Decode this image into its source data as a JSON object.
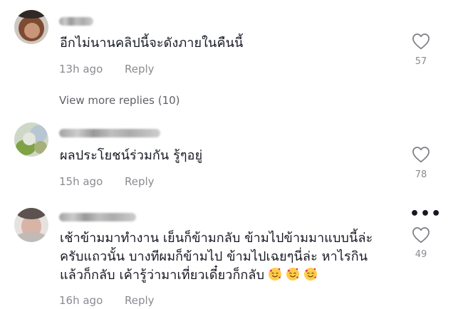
{
  "comments": [
    {
      "text_lines": [
        "อีกไม่นานคลิปนี้จะดังภายในคืนนี้"
      ],
      "time": "13h ago",
      "reply_label": "Reply",
      "likes": "57",
      "icon": "heart-outline-icon"
    },
    {
      "text_lines": [
        "ผลประโยชน์ร่วมกัน รู้ๆอยู่"
      ],
      "time": "15h ago",
      "reply_label": "Reply",
      "likes": "78",
      "icon": "heart-outline-icon"
    },
    {
      "text_lines": [
        "เช้าข้ามมาทำงาน เย็นก็ข้ามกลับ ข้ามไปข้ามมาแบบนี้ล่ะ",
        "ครับแถวนั้น บางทีผมก็ข้ามไป ข้ามไปเฉยๆนี่ล่ะ หาไรกิน",
        "แล้วก็กลับ เค้ารู้ว่ามาเที่ยวเดี๋ยวก็กลับ"
      ],
      "emojis": [
        "smiling-face-with-hearts",
        "smiling-face-with-hearts",
        "smiling-face-with-hearts"
      ],
      "time": "16h ago",
      "reply_label": "Reply",
      "likes": "49",
      "icon": "heart-outline-icon",
      "more_icon": "more-options-icon"
    }
  ],
  "view_more_replies": "View more replies (10)",
  "colors": {
    "text": "#161823",
    "meta": "#8a8b91",
    "view_more": "#5f6066",
    "background": "#ffffff"
  }
}
